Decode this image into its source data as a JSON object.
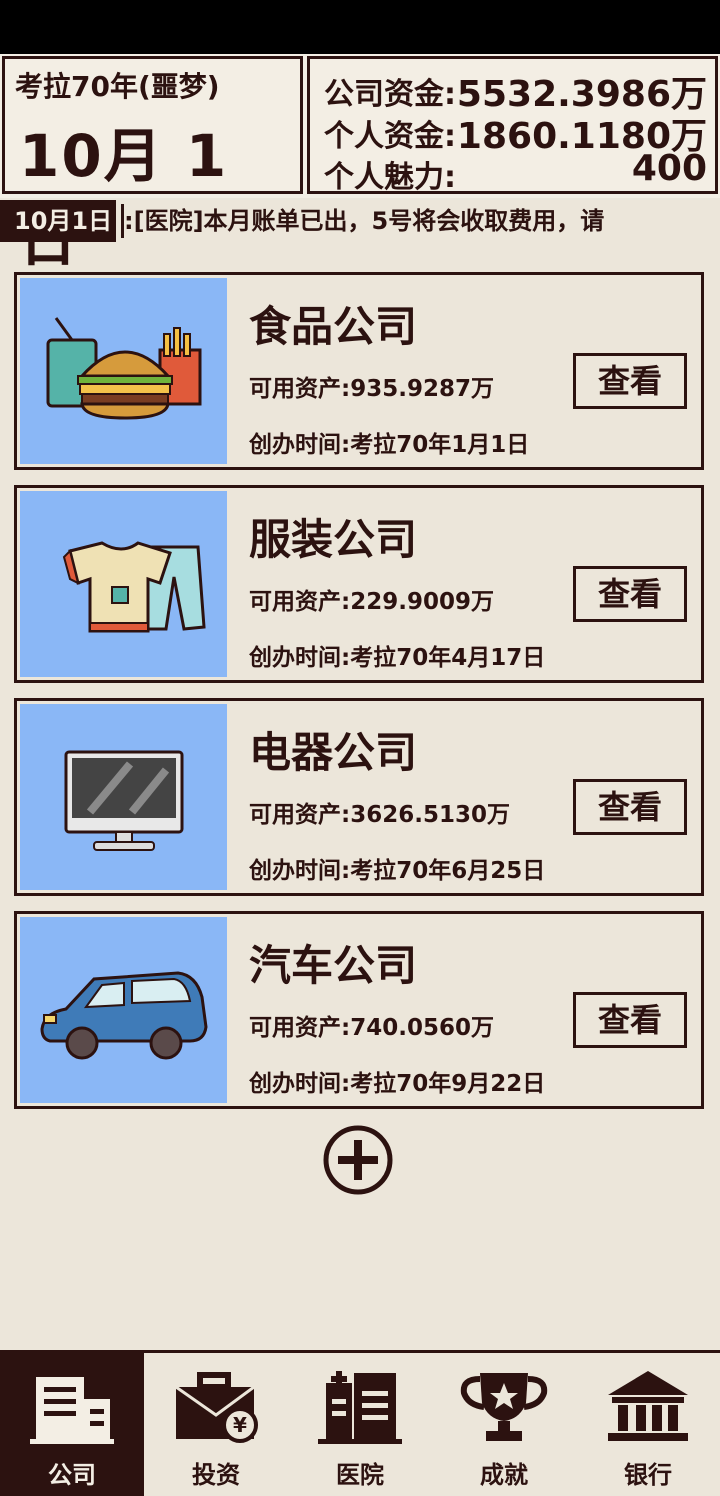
{
  "header": {
    "year_label": "考拉70年(噩梦)",
    "date_label": "10月 1 日",
    "company_funds_label": "公司资金:",
    "company_funds_value": "5532.3986万",
    "personal_funds_label": "个人资金:",
    "personal_funds_value": "1860.1180万",
    "charm_label": "个人魅力:",
    "charm_value": "400"
  },
  "ticker": {
    "date": "10月1日",
    "message": ":[医院]本月账单已出，5号将会收取费用，请"
  },
  "companies": [
    {
      "name": "食品公司",
      "assets": "可用资产:935.9287万",
      "founded": "创办时间:考拉70年1月1日",
      "icon": "food-icon"
    },
    {
      "name": "服装公司",
      "assets": "可用资产:229.9009万",
      "founded": "创办时间:考拉70年4月17日",
      "icon": "clothing-icon"
    },
    {
      "name": "电器公司",
      "assets": "可用资产:3626.5130万",
      "founded": "创办时间:考拉70年6月25日",
      "icon": "monitor-icon"
    },
    {
      "name": "汽车公司",
      "assets": "可用资产:740.0560万",
      "founded": "创办时间:考拉70年9月22日",
      "icon": "car-icon"
    }
  ],
  "view_label": "查看",
  "nav": {
    "items": [
      {
        "label": "公司",
        "icon": "building-icon",
        "active": true
      },
      {
        "label": "投资",
        "icon": "briefcase-icon",
        "active": false
      },
      {
        "label": "医院",
        "icon": "hospital-icon",
        "active": false
      },
      {
        "label": "成就",
        "icon": "trophy-icon",
        "active": false
      },
      {
        "label": "银行",
        "icon": "bank-icon",
        "active": false
      }
    ]
  },
  "colors": {
    "dark": "#2c1210",
    "background": "#ece6da",
    "panel": "#f3eee4",
    "card_image_bg": "#8ab7f6"
  }
}
